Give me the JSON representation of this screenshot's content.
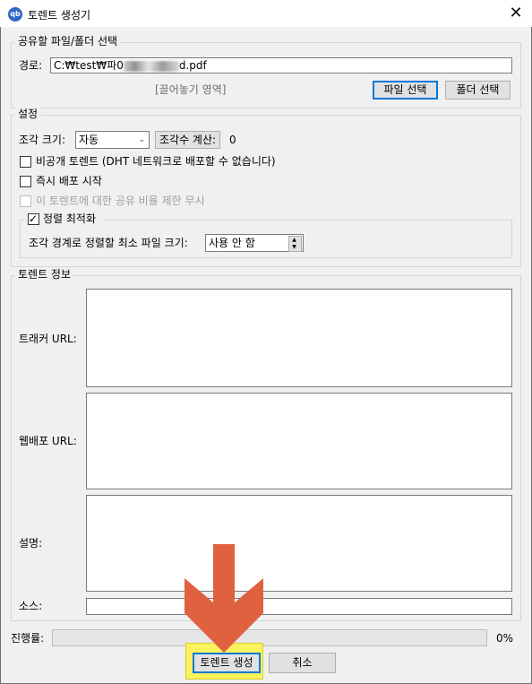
{
  "window": {
    "title": "토렌트 생성기",
    "icon_text": "qb",
    "close_symbol": "✕"
  },
  "source": {
    "group_title": "공유할 파일/폴더 선택",
    "path_label": "경로:",
    "path_prefix": "C:₩test₩파0",
    "path_suffix": "d.pdf",
    "drop_zone": "[끌어놓기 영역]",
    "select_file_button": "파일 선택",
    "select_folder_button": "폴더 선택"
  },
  "settings": {
    "group_title": "설정",
    "piece_size_label": "조각 크기:",
    "piece_size_value": "자동",
    "calc_pieces_button": "조각수 계산:",
    "piece_count": "0",
    "private_torrent_label": "비공개 토렌트 (DHT 네트워크로 배포할 수 없습니다)",
    "private_torrent_checked": false,
    "start_seeding_label": "즉시 배포 시작",
    "start_seeding_checked": false,
    "ignore_ratio_label": "이 토렌트에 대한 공유 비율 제한 무시",
    "ignore_ratio_checked": false,
    "ignore_ratio_enabled": false,
    "optimize_alignment_label": "정렬 최적화",
    "optimize_alignment_checked": true,
    "min_file_size_label": "조각 경계로 정렬할 최소 파일 크기:",
    "min_file_size_value": "사용 안 함"
  },
  "torrent_info": {
    "group_title": "토렌트 정보",
    "tracker_label": "트래커 URL:",
    "tracker_value": "",
    "webseed_label": "웹배포 URL:",
    "webseed_value": "",
    "comment_label": "설명:",
    "comment_value": "",
    "source_label": "소스:",
    "source_value": ""
  },
  "progress": {
    "label": "진행률:",
    "value": 0,
    "text": "0%"
  },
  "footer": {
    "create_button": "토렌트 생성",
    "cancel_button": "취소"
  },
  "colors": {
    "highlight": "#faf35c",
    "arrow": "#e0613f",
    "default_button_border": "#0078d7"
  }
}
